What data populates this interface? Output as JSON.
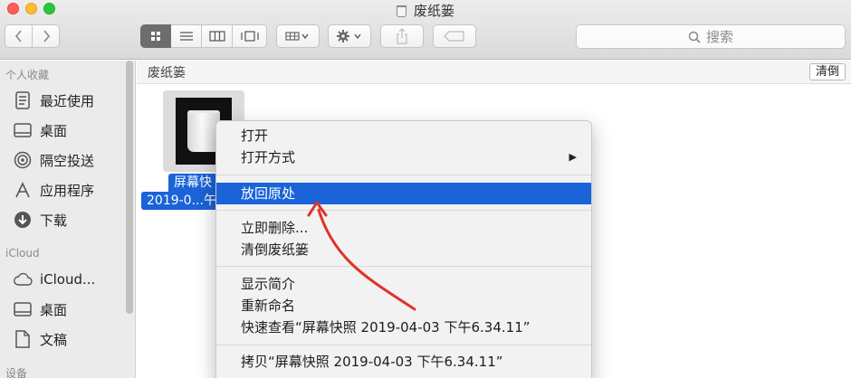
{
  "window": {
    "title": "废纸篓"
  },
  "toolbar": {
    "back_icon": "chevron-left-icon",
    "forward_icon": "chevron-right-icon",
    "search_placeholder": "搜索"
  },
  "sidebar": {
    "sections": [
      {
        "header": "个人收藏",
        "items": [
          {
            "label": "最近使用",
            "icon": "recents-icon"
          },
          {
            "label": "桌面",
            "icon": "desktop-icon"
          },
          {
            "label": "隔空投送",
            "icon": "airdrop-icon"
          },
          {
            "label": "应用程序",
            "icon": "applications-icon"
          },
          {
            "label": "下载",
            "icon": "downloads-icon"
          }
        ]
      },
      {
        "header": "iCloud",
        "items": [
          {
            "label": "iCloud...",
            "icon": "cloud-icon"
          },
          {
            "label": "桌面",
            "icon": "desktop-icon"
          },
          {
            "label": "文稿",
            "icon": "documents-icon"
          }
        ]
      },
      {
        "header": "设备",
        "items": []
      }
    ]
  },
  "pathbar": {
    "location": "废纸篓",
    "empty_button": "清倒"
  },
  "file": {
    "name_line1": "屏幕快",
    "name_line2": "2019-0...午"
  },
  "context_menu": {
    "items": [
      {
        "label": "打开"
      },
      {
        "label": "打开方式",
        "submenu": true
      },
      {
        "label": "放回原处",
        "highlighted": true
      },
      {
        "label": "立即删除..."
      },
      {
        "label": "清倒废纸篓"
      },
      {
        "label": "显示简介"
      },
      {
        "label": "重新命名"
      },
      {
        "label": "快速查看“屏幕快照 2019-04-03 下午6.34.11”"
      },
      {
        "label": "拷贝“屏幕快照 2019-04-03 下午6.34.11”"
      }
    ]
  },
  "colors": {
    "accent": "#1b63d8",
    "annotation_arrow": "#e0322a"
  }
}
